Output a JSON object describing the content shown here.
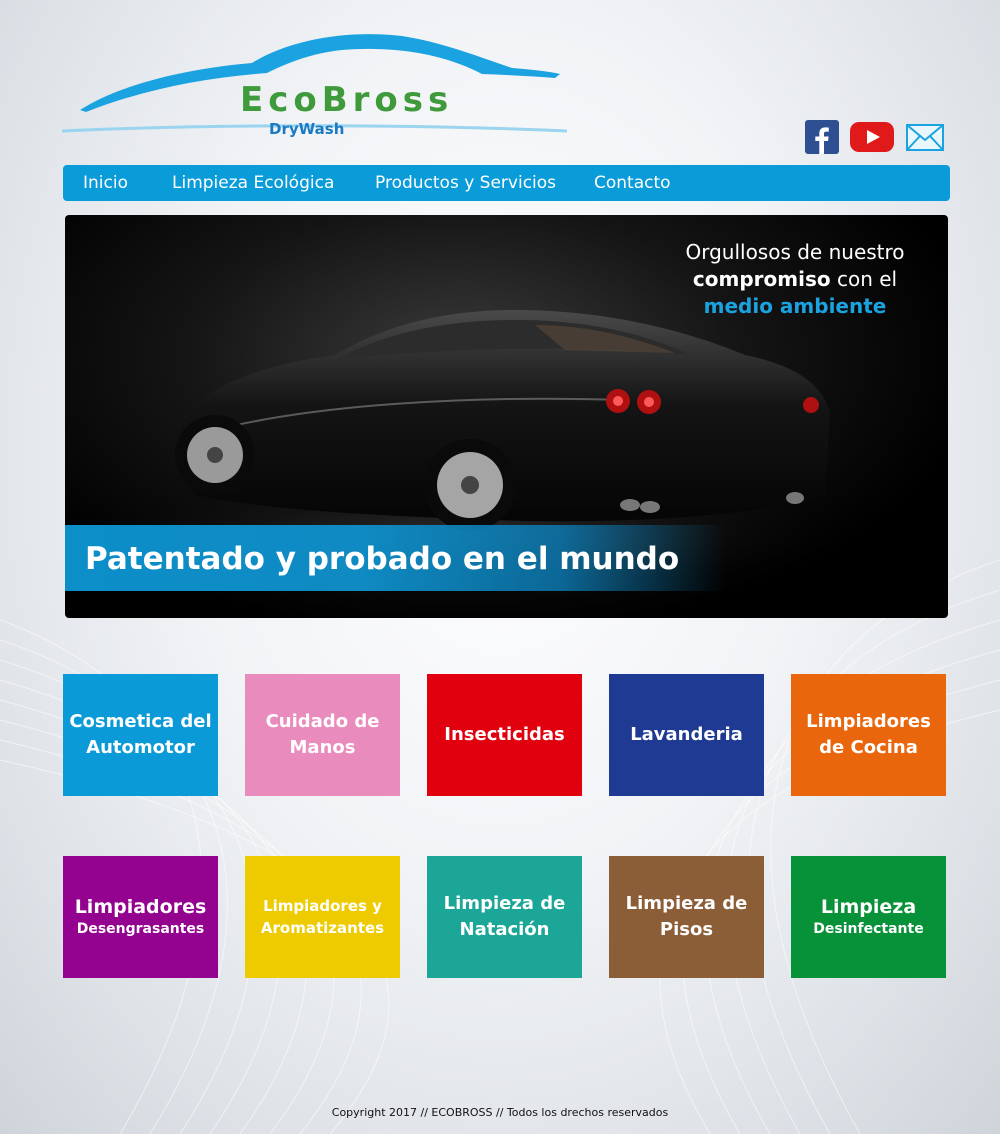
{
  "logo": {
    "name": "EcoBross",
    "tagline": "DryWash"
  },
  "social": {
    "facebook_icon": "facebook-icon",
    "youtube_icon": "youtube-icon",
    "mail_icon": "mail-icon"
  },
  "nav": {
    "items": [
      {
        "label": "Inicio"
      },
      {
        "label": "Limpieza Ecológica"
      },
      {
        "label": "Productos y Servicios"
      },
      {
        "label": "Contacto"
      }
    ]
  },
  "hero": {
    "slogan_line1": "Orgullosos de nuestro",
    "slogan_strong": "compromiso",
    "slogan_rest": " con el",
    "slogan_accent": "medio ambiente",
    "banner": "Patentado y probado en el mundo"
  },
  "tiles": [
    {
      "line1": "Cosmetica del Automotor",
      "color": "#0a9ad8"
    },
    {
      "line1": "Cuidado de Manos",
      "color": "#e98bbd"
    },
    {
      "line1": "Insecticidas",
      "color": "#e0000e"
    },
    {
      "line1": "Lavanderia",
      "color": "#1e3a93"
    },
    {
      "line1": "Limpiadores de Cocina",
      "color": "#ea660c"
    },
    {
      "line1": "Limpiadores",
      "line2": "Desengrasantes",
      "color": "#930390"
    },
    {
      "line1": "Limpiadores y Aromatizantes",
      "color": "#eecb00"
    },
    {
      "line1": "Limpieza de Natación",
      "color": "#1ba697"
    },
    {
      "line1": "Limpieza de Pisos",
      "color": "#8c5e38"
    },
    {
      "line1": "Limpieza",
      "line2": "Desinfectante",
      "color": "#079138"
    }
  ],
  "footer": {
    "text": "Copyright 2017 // ECOBROSS // Todos los drechos reservados"
  }
}
